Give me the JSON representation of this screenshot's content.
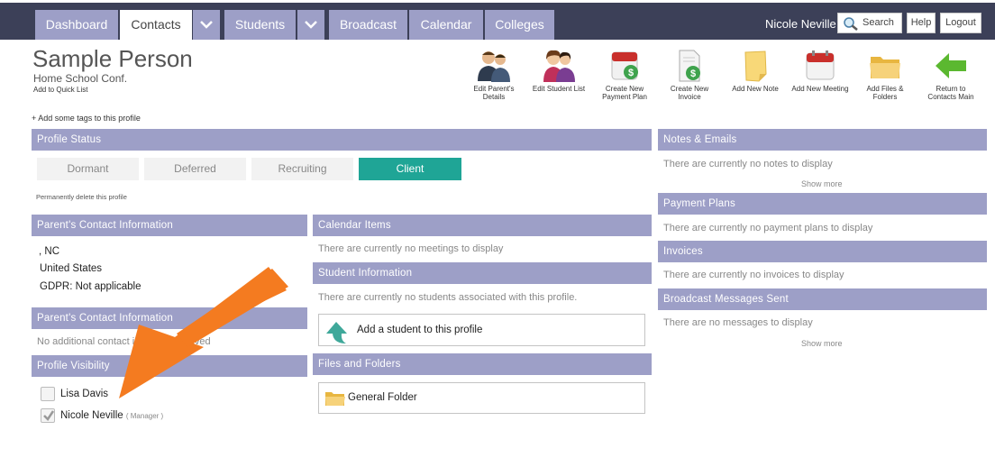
{
  "nav": {
    "tabs": [
      "Dashboard",
      "Contacts",
      "Students",
      "Broadcast",
      "Calendar",
      "Colleges"
    ],
    "active_tab": "Contacts",
    "user_name": "Nicole Neville",
    "search_label": "Search",
    "help_label": "Help",
    "logout_label": "Logout"
  },
  "profile": {
    "name": "Sample Person",
    "subtitle": "Home School Conf.",
    "quick_list": "Add to Quick List",
    "add_tags": "+ Add some tags to this profile"
  },
  "actions": [
    {
      "label": "Edit Parent's Details",
      "icon": "parents-icon"
    },
    {
      "label": "Edit Student List",
      "icon": "students-icon"
    },
    {
      "label": "Create New Payment Plan",
      "icon": "payment-plan-icon"
    },
    {
      "label": "Create New Invoice",
      "icon": "invoice-icon"
    },
    {
      "label": "Add New Note",
      "icon": "note-icon"
    },
    {
      "label": "Add New Meeting",
      "icon": "calendar-icon"
    },
    {
      "label": "Add Files & Folders",
      "icon": "folder-icon"
    },
    {
      "label": "Return to Contacts Main",
      "icon": "back-arrow-icon"
    }
  ],
  "status": {
    "title": "Profile Status",
    "options": [
      "Dormant",
      "Deferred",
      "Recruiting",
      "Client"
    ],
    "selected": "Client",
    "delete_link": "Permanently delete this profile",
    "active_color": "#1fa596"
  },
  "parent_contact": {
    "title": "Parent's Contact Information",
    "lines": [
      ", NC",
      "United States",
      "GDPR:  Not applicable"
    ]
  },
  "parent_contact_2": {
    "title": "Parent's Contact Information",
    "empty_text": "No additional contact information saved"
  },
  "visibility": {
    "title": "Profile Visibility",
    "users": [
      {
        "name": "Lisa Davis",
        "role": "",
        "checked": false
      },
      {
        "name": "Nicole Neville",
        "role": "( Manager )",
        "checked": true
      }
    ]
  },
  "calendar": {
    "title": "Calendar Items",
    "empty_text": "There are currently no meetings to display"
  },
  "student_info": {
    "title": "Student Information",
    "empty_text": "There are currently no students associated with this profile.",
    "add_button": "Add a student to this profile"
  },
  "files": {
    "title": "Files and Folders",
    "folder_name": "General Folder"
  },
  "notes": {
    "title": "Notes & Emails",
    "empty_text": "There are currently no notes to display",
    "show_more": "Show more"
  },
  "payment_plans": {
    "title": "Payment Plans",
    "empty_text": "There are currently no payment plans to display"
  },
  "invoices": {
    "title": "Invoices",
    "empty_text": "There are currently no invoices to display"
  },
  "broadcast_sent": {
    "title": "Broadcast Messages Sent",
    "empty_text": "There are no messages to display",
    "show_more": "Show more"
  },
  "colors": {
    "nav_bg": "#3c4058",
    "tab_bg": "#9d9fc7",
    "section_bar": "#9d9fc7",
    "annotation_arrow": "#f47b20"
  }
}
